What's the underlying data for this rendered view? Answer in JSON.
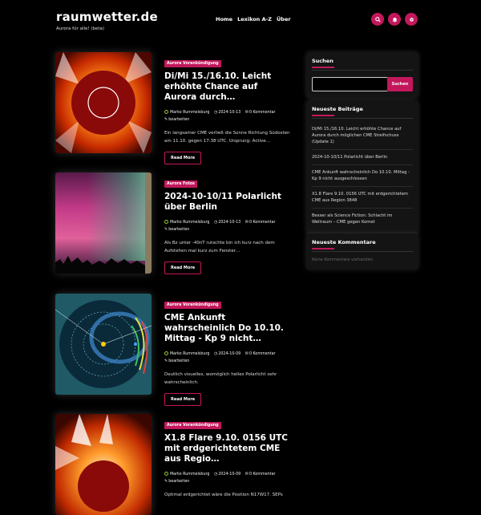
{
  "site": {
    "title": "raumwetter.de",
    "tagline": "Aurora für alle! (beta)"
  },
  "nav": {
    "items": [
      "Home",
      "Lexikon A-Z",
      "Über"
    ]
  },
  "header_icons": [
    "search-icon",
    "bell-icon",
    "settings-icon"
  ],
  "posts": [
    {
      "category": "Aurora Vorankündigung",
      "title": "Di/Mi 15./16.10. Leicht erhöhte Chance auf Aurora durch…",
      "author": "Marko Rummelsburg",
      "date": "2024-10-13",
      "comments": "0 Kommentar",
      "edit": "bearbeiten",
      "excerpt": "Ein langsamer CME verließ die Sonne Richtung Südosten am 11.10. gegen 17:38 UTC. Ursprung: Active…",
      "read_more": "Read More"
    },
    {
      "category": "Aurora Fotos",
      "title": "2024-10-10/11 Polarlicht über Berlin",
      "author": "Marko Rummelsburg",
      "date": "2024-10-13",
      "comments": "0 Kommentar",
      "edit": "bearbeiten",
      "excerpt": "Als Bz unter -40nT rutschte bin ich kurz nach dem Aufstehen mal kurz zum Fenster…",
      "read_more": "Read More"
    },
    {
      "category": "Aurora Vorankündigung",
      "title": "CME Ankunft wahrscheinlich Do 10.10. Mittag - Kp 9 nicht…",
      "author": "Marko Rummelsburg",
      "date": "2024-10-09",
      "comments": "0 Kommentar",
      "edit": "bearbeiten",
      "excerpt": "Deutlich visuelles, womöglich helles Polarlicht sehr wahrscheinlich.",
      "read_more": "Read More"
    },
    {
      "category": "Aurora Vorankündigung",
      "title": "X1.8 Flare 9.10. 0156 UTC mit erdgerichtetem CME aus Regio…",
      "author": "Marko Rummelsburg",
      "date": "2024-10-09",
      "comments": "0 Kommentar",
      "edit": "bearbeiten",
      "excerpt": "Optimal erdgerichtet wäre die Position N17W17. SEPs",
      "read_more": "Read More"
    }
  ],
  "sidebar": {
    "search": {
      "title": "Suchen",
      "button": "Suchen",
      "value": ""
    },
    "recent": {
      "title": "Neueste Beiträge",
      "items": [
        "Di/Mi 15./16.10. Leicht erhöhte Chance auf Aurora durch möglichen CME Streifschuss (Update 1)",
        "2024-10-10/11 Polarlicht über Berlin",
        "CME Ankunft wahrscheinlich Do 10.10. Mittag - Kp 9 nicht ausgeschlossen",
        "X1.8 Flare 9.10. 0156 UTC mit erdgerichtetem CME aus Region 3848",
        "Besser als Science Fiction: Schlacht im Weltraum – CME gegen Komet"
      ]
    },
    "comments": {
      "title": "Neueste Kommentare",
      "empty": "Keine Kommentare vorhanden."
    }
  },
  "colors": {
    "accent": "#c2185b",
    "background": "#000000",
    "widget": "#141414"
  }
}
